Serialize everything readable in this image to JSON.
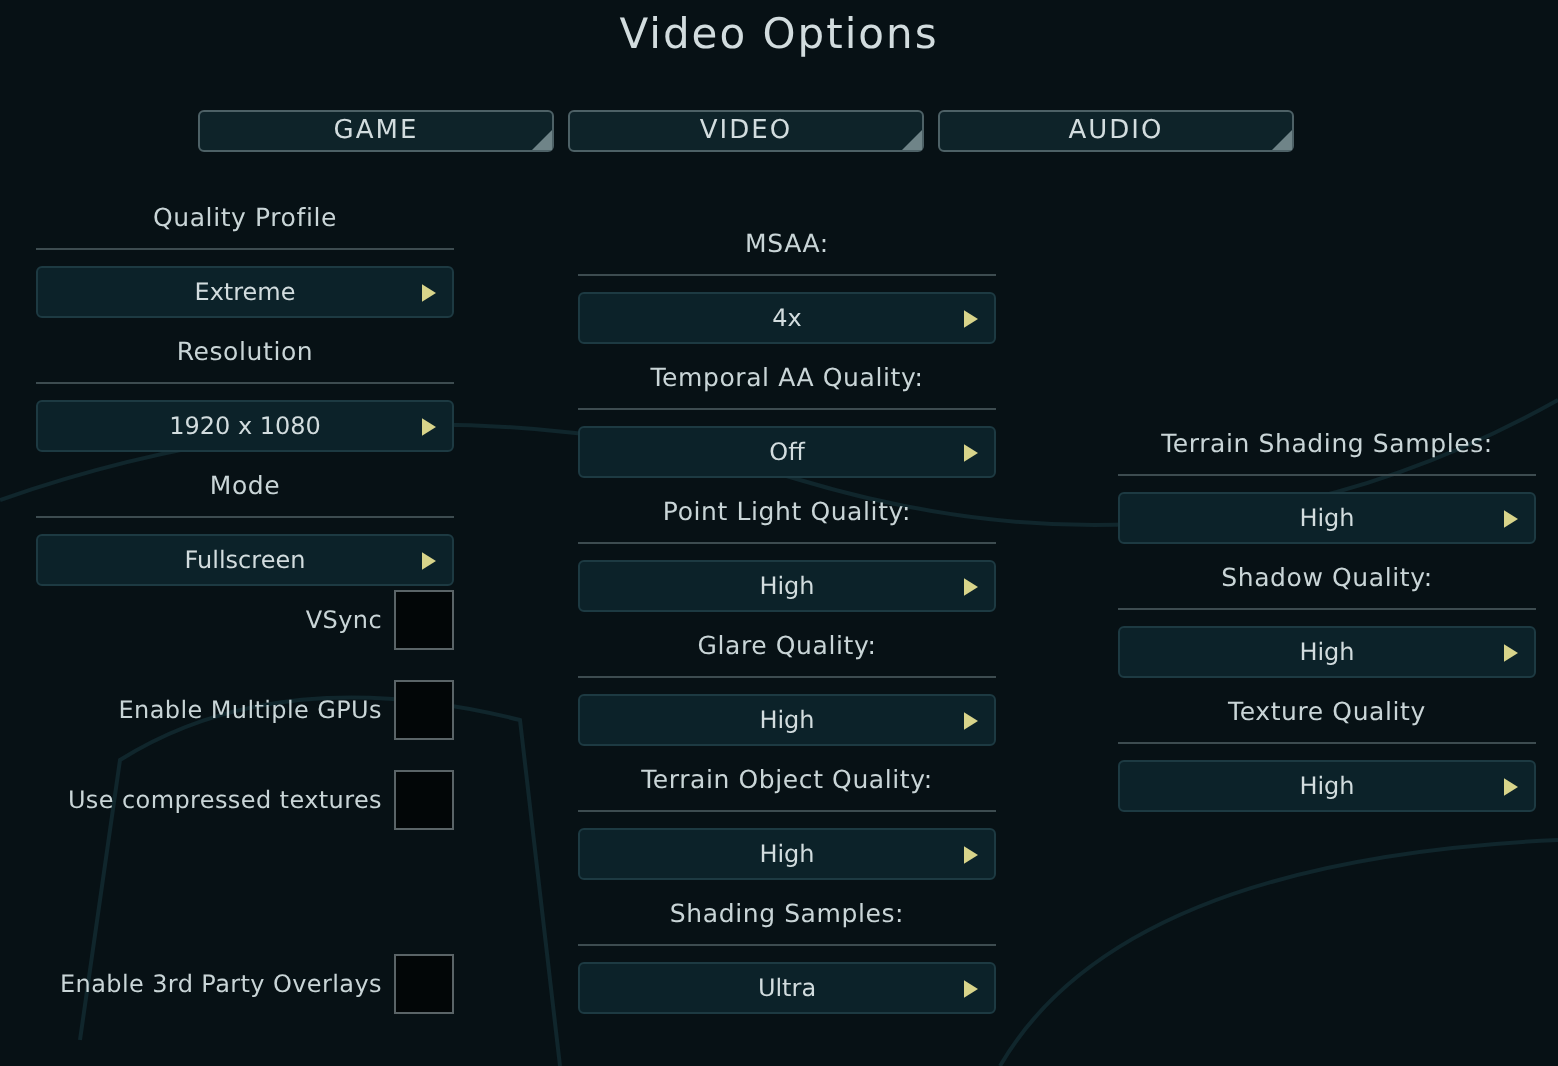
{
  "title": "Video Options",
  "tabs": [
    {
      "label": "GAME"
    },
    {
      "label": "VIDEO"
    },
    {
      "label": "AUDIO"
    }
  ],
  "columns": [
    {
      "settings": [
        {
          "label": "Quality Profile",
          "value": "Extreme"
        },
        {
          "label": "Resolution",
          "value": "1920 x 1080"
        },
        {
          "label": "Mode",
          "value": "Fullscreen"
        }
      ],
      "checkboxes": [
        {
          "label": "VSync",
          "checked": false
        },
        {
          "label": "Enable Multiple GPUs",
          "checked": false
        },
        {
          "label": "Use compressed textures",
          "checked": false
        },
        {
          "label": "Enable 3rd Party Overlays",
          "checked": false
        }
      ]
    },
    {
      "settings": [
        {
          "label": "MSAA:",
          "value": "4x"
        },
        {
          "label": "Temporal AA Quality:",
          "value": "Off"
        },
        {
          "label": "Point Light Quality:",
          "value": "High"
        },
        {
          "label": "Glare Quality:",
          "value": "High"
        },
        {
          "label": "Terrain Object Quality:",
          "value": "High"
        },
        {
          "label": "Shading Samples:",
          "value": "Ultra"
        }
      ]
    },
    {
      "settings": [
        {
          "label": "Terrain Shading Samples:",
          "value": "High"
        },
        {
          "label": "Shadow Quality:",
          "value": "High"
        },
        {
          "label": "Texture Quality",
          "value": "High"
        }
      ]
    }
  ]
}
